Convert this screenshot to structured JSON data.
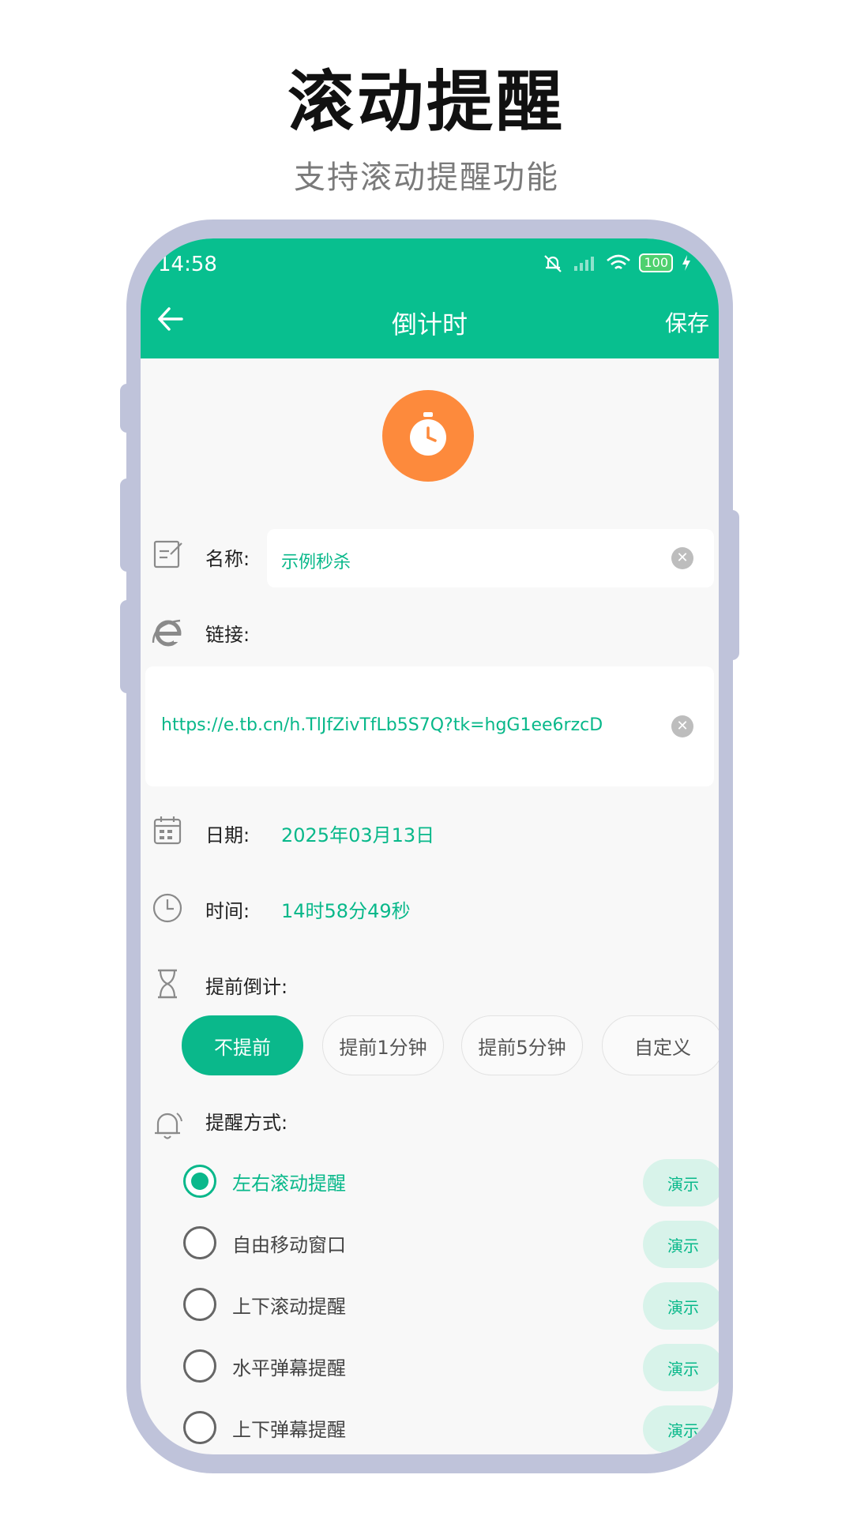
{
  "hero": {
    "title": "滚动提醒",
    "subtitle": "支持滚动提醒功能"
  },
  "status_bar": {
    "time": "14:58",
    "battery": "100"
  },
  "nav": {
    "title": "倒计时",
    "save_label": "保存"
  },
  "form": {
    "name": {
      "label": "名称:",
      "value": "示例秒杀"
    },
    "link": {
      "label": "链接:",
      "value": "https://e.tb.cn/h.TlJfZivTfLb5S7Q?tk=hgG1ee6rzcD"
    },
    "date": {
      "label": "日期:",
      "value": "2025年03月13日"
    },
    "time": {
      "label": "时间:",
      "value": "14时58分49秒"
    },
    "advance": {
      "label": "提前倒计:",
      "options": [
        "不提前",
        "提前1分钟",
        "提前5分钟",
        "自定义"
      ],
      "selected": "不提前"
    },
    "reminder": {
      "label": "提醒方式:",
      "demo_label": "演示",
      "options": [
        "左右滚动提醒",
        "自由移动窗口",
        "上下滚动提醒",
        "水平弹幕提醒",
        "上下弹幕提醒"
      ],
      "selected": "左右滚动提醒"
    }
  },
  "colors": {
    "primary": "#08bf8f",
    "accent_orange": "#fd8a3c",
    "frame": "#bfc3da"
  },
  "icons": [
    "back-arrow-icon",
    "mute-icon",
    "signal-icon",
    "wifi-icon",
    "battery-icon",
    "stopwatch-icon",
    "edit-icon",
    "browser-icon",
    "calendar-icon",
    "clock-icon",
    "hourglass-icon",
    "bell-icon",
    "clear-icon"
  ]
}
